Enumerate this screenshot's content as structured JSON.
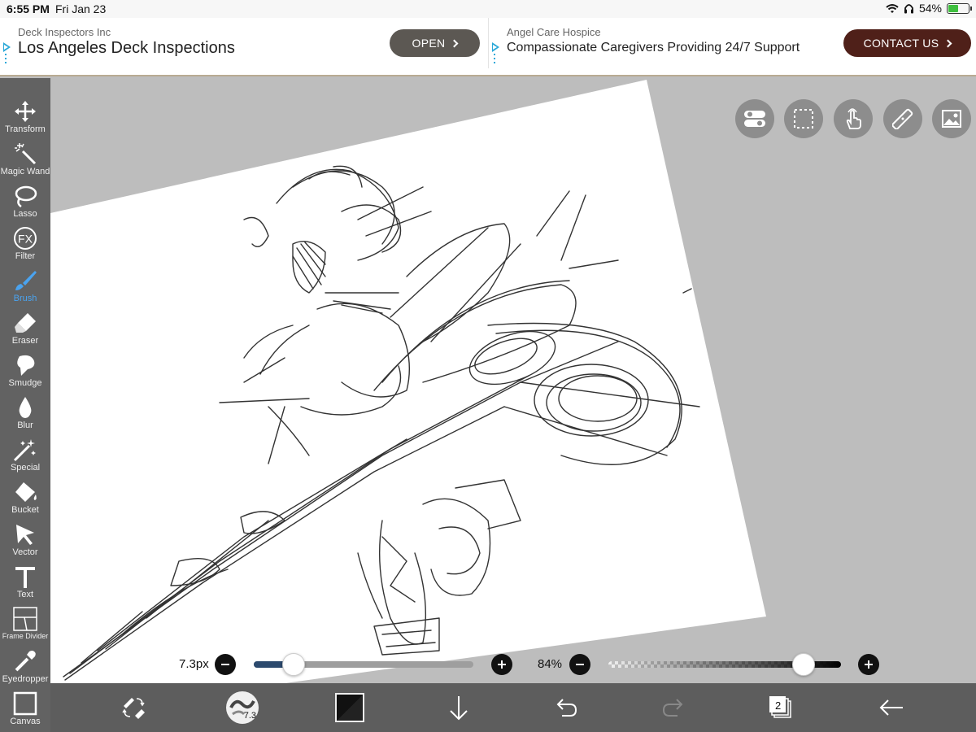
{
  "status": {
    "time": "6:55 PM",
    "date": "Fri Jan 23",
    "battery": "54%",
    "battery_level": 0.54
  },
  "ads": [
    {
      "advertiser": "Deck Inspectors Inc",
      "headline": "Los Angeles Deck Inspections",
      "button": "OPEN"
    },
    {
      "advertiser": "Angel Care Hospice",
      "headline": "Compassionate Caregivers Providing 24/7 Support",
      "button": "CONTACT US"
    }
  ],
  "tools": [
    {
      "label": "Transform",
      "icon": "move-arrows-icon"
    },
    {
      "label": "Magic Wand",
      "icon": "magic-wand-icon"
    },
    {
      "label": "Lasso",
      "icon": "lasso-icon"
    },
    {
      "label": "Filter",
      "icon": "fx-icon"
    },
    {
      "label": "Brush",
      "icon": "brush-icon",
      "active": true
    },
    {
      "label": "Eraser",
      "icon": "eraser-icon"
    },
    {
      "label": "Smudge",
      "icon": "smudge-icon"
    },
    {
      "label": "Blur",
      "icon": "drop-icon"
    },
    {
      "label": "Special",
      "icon": "sparkle-icon"
    },
    {
      "label": "Bucket",
      "icon": "bucket-icon"
    },
    {
      "label": "Vector",
      "icon": "cursor-arrow-icon"
    },
    {
      "label": "Text",
      "icon": "text-icon"
    },
    {
      "label": "Frame Divider",
      "icon": "frame-divider-icon"
    },
    {
      "label": "Eyedropper",
      "icon": "eyedropper-icon"
    },
    {
      "label": "Canvas",
      "icon": "canvas-icon"
    }
  ],
  "brush": {
    "size": "7.3px",
    "size_fraction": 0.18,
    "opacity": "84%",
    "opacity_fraction": 0.84,
    "thumbnail_size": "7.3"
  },
  "layers": {
    "count": "2"
  },
  "colors": {
    "accent": "#4aa3ef",
    "current_color": "#111111",
    "toolbar": "#555555",
    "bottombar": "#5d5d5d",
    "slider_fill": "#2c4a6e"
  }
}
